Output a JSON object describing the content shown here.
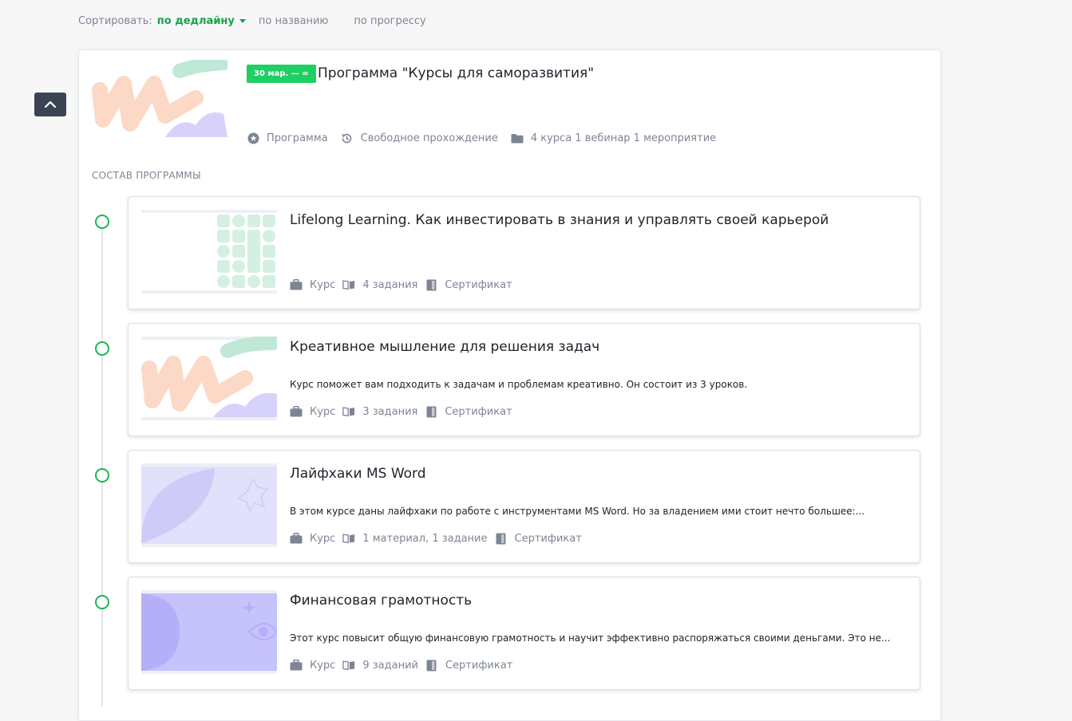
{
  "sort": {
    "label": "Сортировать:",
    "options": [
      "по дедлайну",
      "по названию",
      "по прогрессу"
    ],
    "active_color": "#18a24a"
  },
  "program": {
    "date_badge": "30 мар. — ∞",
    "title": "Программа \"Курсы для саморазвития\"",
    "meta": [
      {
        "icon": "star-circle-icon",
        "label": "Программа"
      },
      {
        "icon": "history-icon",
        "label": "Свободное прохождение"
      },
      {
        "icon": "folder-icon",
        "label": "4 курса 1 вебинар 1 мероприятие"
      }
    ],
    "section_title": "СОСТАВ ПРОГРАММЫ"
  },
  "courses": [
    {
      "title": "Lifelong Learning. Как инвестировать в знания и управлять своей карьерой",
      "description": "",
      "type": "Курс",
      "tasks": "4 задания",
      "certificate": "Сертификат"
    },
    {
      "title": "Креативное мышление для решения задач",
      "description": "Курс поможет вам подходить к задачам и проблемам креативно. Он состоит из 3 уроков.",
      "type": "Курс",
      "tasks": "3 задания",
      "certificate": "Сертификат"
    },
    {
      "title": "Лайфхаки MS Word",
      "description": "В этом курсе даны лайфхаки по работе с инструментами MS Word. Но за владением ими стоит нечто большее:...",
      "type": "Курс",
      "tasks": "1 материал, 1 задание",
      "certificate": "Сертификат"
    },
    {
      "title": "Финансовая грамотность",
      "description": "Этот курс повысит общую финансовую грамотность и научит эффективно распоряжаться своими деньгами. Это не...",
      "type": "Курс",
      "tasks": "9 заданий",
      "certificate": "Сертификат"
    }
  ],
  "colors": {
    "accent_green": "#1fcf64",
    "timeline_green": "#1fb356",
    "muted": "#7d8594",
    "scroll_button": "#3b4452"
  }
}
